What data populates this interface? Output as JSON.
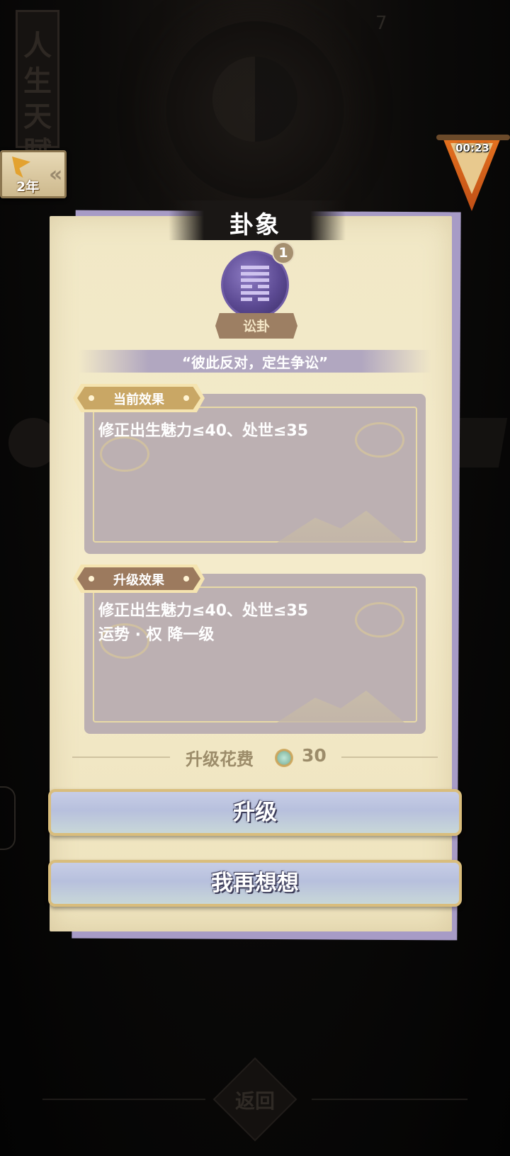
{
  "background": {
    "scroll_title": "人生天賦",
    "counter": "7",
    "back_label": "返回"
  },
  "year_badge": {
    "label": "2年"
  },
  "timer": {
    "value": "00:23"
  },
  "dialog": {
    "title": "卦象",
    "hexagram": {
      "name": "讼卦",
      "level": "1",
      "lines": [
        "yang",
        "yang",
        "yang",
        "yin",
        "yang",
        "yin"
      ]
    },
    "quote": "“彼此反对，定生争讼”",
    "current_effect": {
      "tag": "当前效果",
      "lines": [
        "修正出生魅力≤40、处世≤35"
      ]
    },
    "upgrade_effect": {
      "tag": "升级效果",
      "lines": [
        "修正出生魅力≤40、处世≤35",
        "运势 · 权 降一级"
      ]
    },
    "cost": {
      "label": "升级花费",
      "value": "30",
      "currency_icon": "jade-coin-icon"
    },
    "buttons": {
      "upgrade": "升级",
      "reconsider": "我再想想"
    }
  },
  "colors": {
    "paper": "#f3eaca",
    "panel": "#bcb0b2",
    "accent_purple": "#a79bc6",
    "gold": "#d9bd7c",
    "cost_text": "#9c8c6a"
  }
}
